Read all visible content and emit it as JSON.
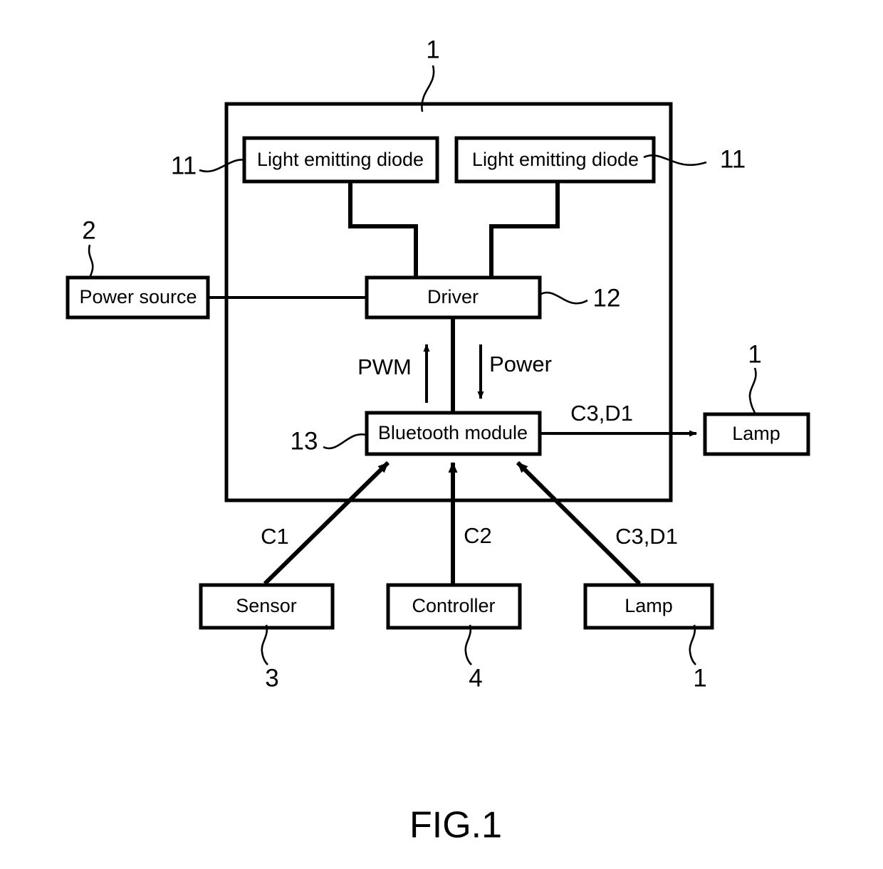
{
  "figure": {
    "caption": "FIG.1"
  },
  "blocks": {
    "led_left": {
      "label": "Light emitting diode"
    },
    "led_right": {
      "label": "Light emitting diode"
    },
    "driver": {
      "label": "Driver"
    },
    "bluetooth": {
      "label": "Bluetooth module"
    },
    "power_source": {
      "label": "Power source"
    },
    "lamp_right": {
      "label": "Lamp"
    },
    "sensor": {
      "label": "Sensor"
    },
    "controller": {
      "label": "Controller"
    },
    "lamp_bottom": {
      "label": "Lamp"
    }
  },
  "reference_numerals": {
    "lamp_assembly_top": "1",
    "power_source": "2",
    "led_left": "11",
    "led_right": "11",
    "driver": "12",
    "bluetooth": "13",
    "lamp_right": "1",
    "sensor": "3",
    "controller": "4",
    "lamp_bottom": "1"
  },
  "signal_labels": {
    "pwm": "PWM",
    "power": "Power",
    "bluetooth_to_lamp": "C3,D1",
    "sensor_to_bluetooth": "C1",
    "controller_to_bluetooth": "C2",
    "lamp_to_bluetooth": "C3,D1"
  },
  "colors": {
    "stroke": "#000000",
    "background": "#ffffff"
  }
}
